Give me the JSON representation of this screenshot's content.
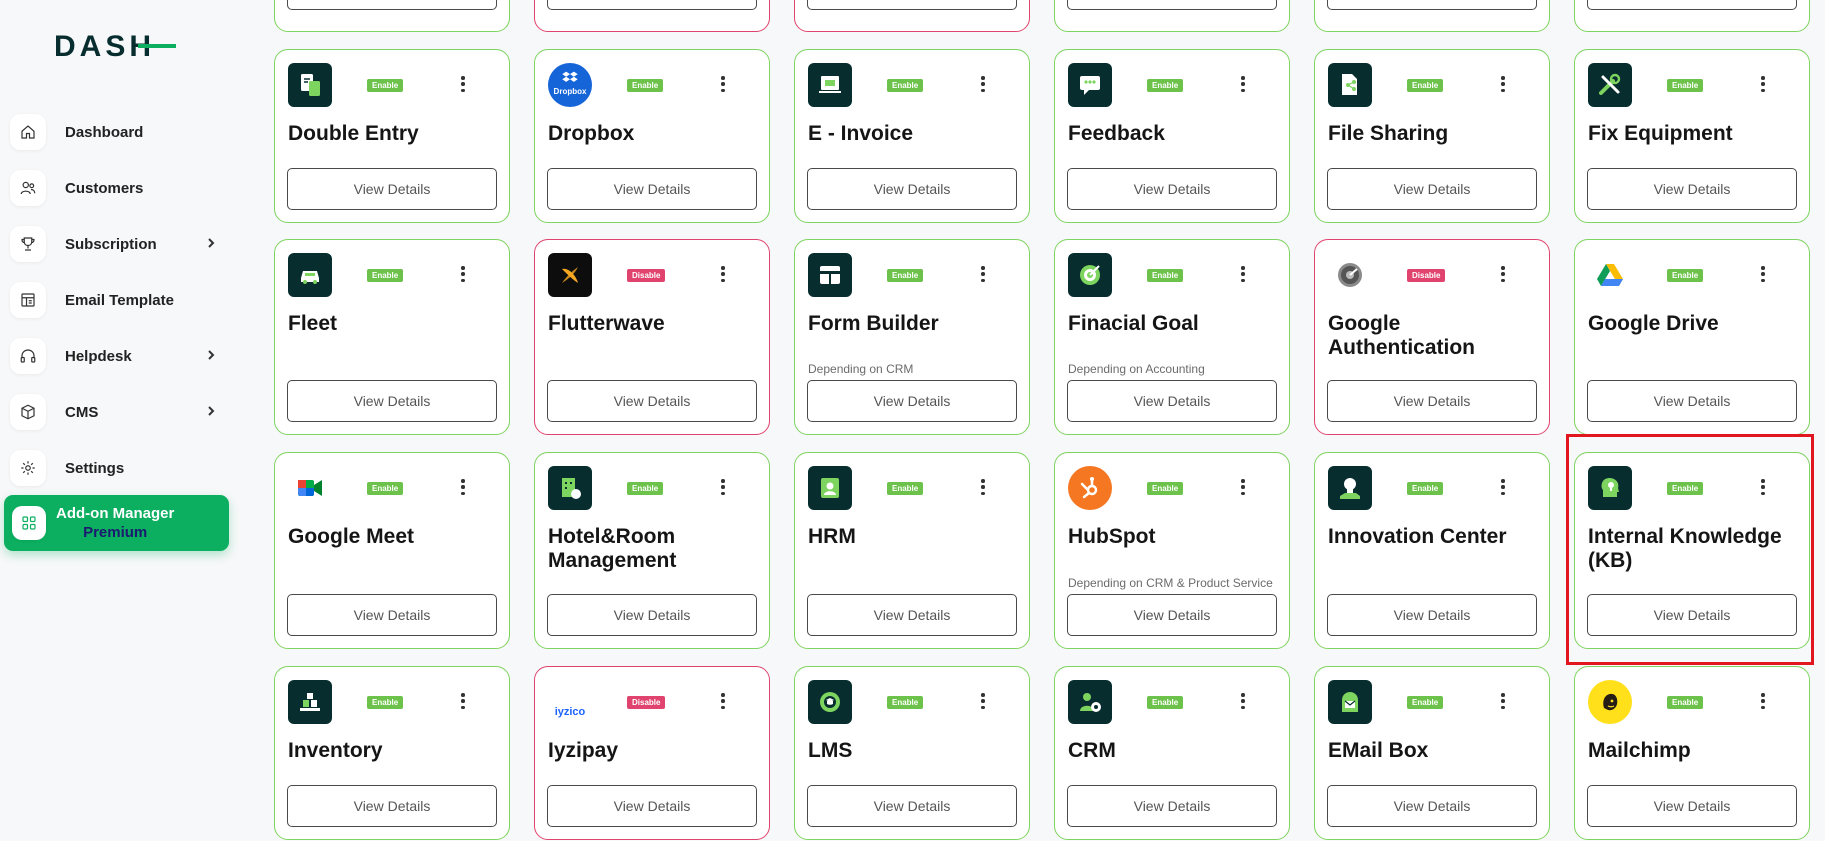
{
  "sidebar": {
    "brand": "DASH",
    "items": [
      {
        "label": "Dashboard",
        "icon": "home-icon",
        "chevron": false
      },
      {
        "label": "Customers",
        "icon": "users-icon",
        "chevron": false
      },
      {
        "label": "Subscription",
        "icon": "trophy-icon",
        "chevron": true
      },
      {
        "label": "Email Template",
        "icon": "template-icon",
        "chevron": false
      },
      {
        "label": "Helpdesk",
        "icon": "headphones-icon",
        "chevron": true
      },
      {
        "label": "CMS",
        "icon": "box-icon",
        "chevron": true
      },
      {
        "label": "Settings",
        "icon": "gear-icon",
        "chevron": false
      }
    ],
    "active": {
      "label": "Add-on Manager",
      "sub": "Premium",
      "icon": "grid-icon"
    }
  },
  "common": {
    "view_label": "View Details",
    "enable": "Enable",
    "disable": "Disable"
  },
  "top_row": [
    {
      "status": "enable"
    },
    {
      "status": "disable"
    },
    {
      "status": "disable"
    },
    {
      "status": "enable"
    },
    {
      "status": "enable"
    },
    {
      "status": "enable"
    }
  ],
  "rows": [
    [
      {
        "title": "Double Entry",
        "status": "enable",
        "icon": "ledger-icon",
        "note": ""
      },
      {
        "title": "Dropbox",
        "status": "enable",
        "icon": "dropbox-icon",
        "note": "",
        "icon_text": "Dropbox"
      },
      {
        "title": "E - Invoice",
        "status": "enable",
        "icon": "invoice-icon",
        "note": ""
      },
      {
        "title": "Feedback",
        "status": "enable",
        "icon": "feedback-icon",
        "note": ""
      },
      {
        "title": "File Sharing",
        "status": "enable",
        "icon": "file-share-icon",
        "note": ""
      },
      {
        "title": "Fix Equipment",
        "status": "enable",
        "icon": "tools-icon",
        "note": ""
      }
    ],
    [
      {
        "title": "Fleet",
        "status": "enable",
        "icon": "car-icon",
        "note": ""
      },
      {
        "title": "Flutterwave",
        "status": "disable",
        "icon": "flutterwave-icon",
        "note": ""
      },
      {
        "title": "Form Builder",
        "status": "enable",
        "icon": "form-icon",
        "note": "Depending on CRM"
      },
      {
        "title": "Finacial Goal",
        "status": "enable",
        "icon": "target-icon",
        "note": "Depending on Accounting"
      },
      {
        "title": "Google Authentication",
        "status": "disable",
        "icon": "google-auth-icon",
        "note": ""
      },
      {
        "title": "Google Drive",
        "status": "enable",
        "icon": "google-drive-icon",
        "note": ""
      }
    ],
    [
      {
        "title": "Google Meet",
        "status": "enable",
        "icon": "google-meet-icon",
        "note": ""
      },
      {
        "title": "Hotel&Room Management",
        "status": "enable",
        "icon": "hotel-icon",
        "note": ""
      },
      {
        "title": "HRM",
        "status": "enable",
        "icon": "id-card-icon",
        "note": ""
      },
      {
        "title": "HubSpot",
        "status": "enable",
        "icon": "hubspot-icon",
        "note": "Depending on CRM & Product Service"
      },
      {
        "title": "Innovation Center",
        "status": "enable",
        "icon": "bulb-icon",
        "note": ""
      },
      {
        "title": "Internal Knowledge (KB)",
        "status": "enable",
        "icon": "knowledge-icon",
        "note": ""
      }
    ],
    [
      {
        "title": "Inventory",
        "status": "enable",
        "icon": "inventory-icon",
        "note": ""
      },
      {
        "title": "Iyzipay",
        "status": "disable",
        "icon": "iyzico-icon",
        "note": "",
        "icon_text": "iyzico"
      },
      {
        "title": "LMS",
        "status": "enable",
        "icon": "lms-icon",
        "note": ""
      },
      {
        "title": "CRM",
        "status": "enable",
        "icon": "crm-icon",
        "note": ""
      },
      {
        "title": "EMail Box",
        "status": "enable",
        "icon": "mailbox-icon",
        "note": ""
      },
      {
        "title": "Mailchimp",
        "status": "enable",
        "icon": "mailchimp-icon",
        "note": ""
      }
    ]
  ],
  "colors": {
    "accent": "#0caf60",
    "enable": "#6cc24a",
    "disable": "#e0446e",
    "icon_bg": "#082d2f",
    "highlight": "#e2161e"
  }
}
